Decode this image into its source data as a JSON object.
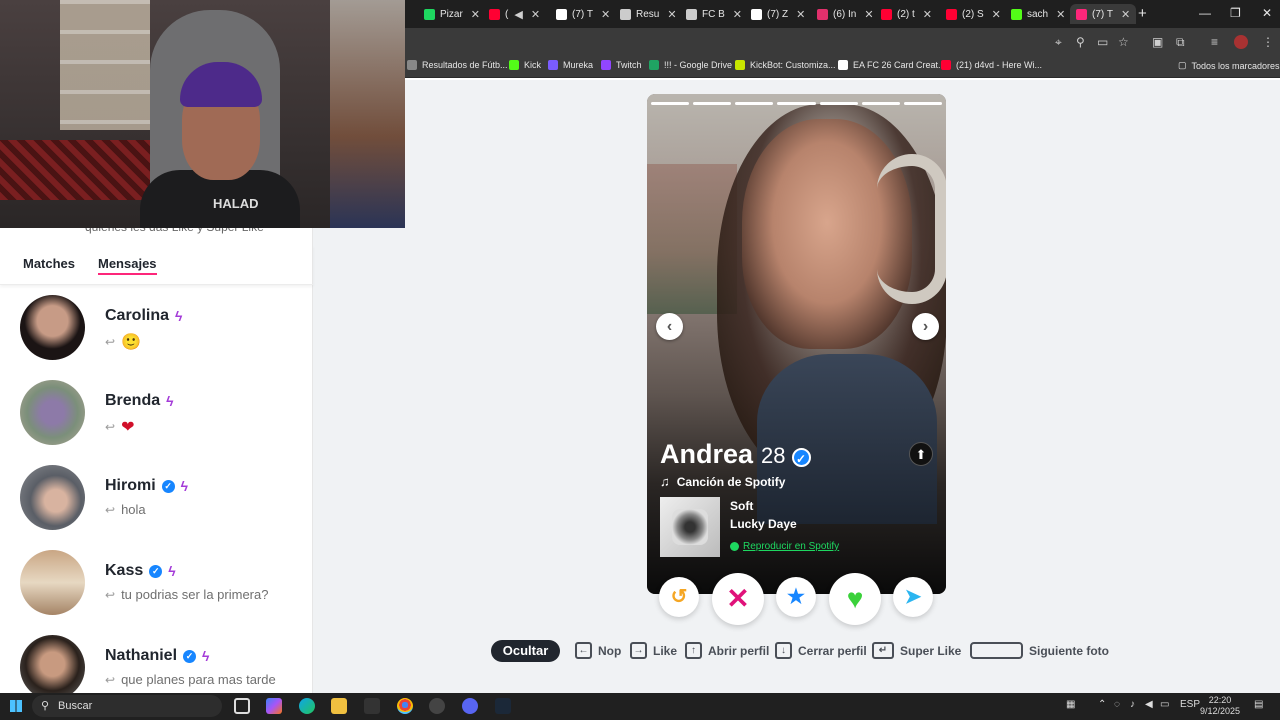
{
  "browser": {
    "tabs": [
      {
        "label": "Pizar",
        "color": "#1ed760"
      },
      {
        "label": "(",
        "color": "#ff0033"
      },
      {
        "label": "(7) T",
        "color": "#ffffff"
      },
      {
        "label": "Resu",
        "color": "#cccccc"
      },
      {
        "label": "FC B",
        "color": "#cccccc"
      },
      {
        "label": "(7) Z",
        "color": "#ffffff"
      },
      {
        "label": "(6) In",
        "color": "#e1306c"
      },
      {
        "label": "(2) t",
        "color": "#ff0033"
      },
      {
        "label": "(2) S",
        "color": "#ff0033"
      },
      {
        "label": "sach",
        "color": "#53fc18"
      },
      {
        "label": "(7) T",
        "color": "#fd267a"
      }
    ],
    "bookmarks": [
      {
        "label": "Resultados de Fútb...",
        "color": "#888888"
      },
      {
        "label": "Kick",
        "color": "#53fc18"
      },
      {
        "label": "Mureka",
        "color": "#7a5cff"
      },
      {
        "label": "Twitch",
        "color": "#9146ff"
      },
      {
        "label": "!!! - Google Drive",
        "color": "#1fa463"
      },
      {
        "label": "KickBot: Customiza...",
        "color": "#c8e600"
      },
      {
        "label": "EA FC 26 Card Creat...",
        "color": "#ffffff"
      },
      {
        "label": "(21) d4vd - Here Wi...",
        "color": "#ff0033"
      }
    ],
    "all_bookmarks": "Todos los marcadores"
  },
  "sidebar": {
    "subtitle": "quienes les das Like y Super Like",
    "tab_matches": "Matches",
    "tab_messages": "Mensajes",
    "conversations": [
      {
        "name": "Carolina",
        "message": "🙂",
        "verified": false
      },
      {
        "name": "Brenda",
        "message": "❤",
        "verified": false
      },
      {
        "name": "Hiromi",
        "message": "hola",
        "verified": true
      },
      {
        "name": "Kass",
        "message": "tu podrias ser la primera?",
        "verified": true
      },
      {
        "name": "Nathaniel",
        "message": "que planes para mas tarde",
        "verified": true
      }
    ]
  },
  "card": {
    "name": "Andrea",
    "age": "28",
    "spotify_label": "Canción de Spotify",
    "song": "Soft",
    "artist": "Lucky Daye",
    "play_label": "Reproducir en Spotify",
    "photo_index": 7,
    "photo_count": 7
  },
  "actions": {
    "rewind_icon": "rewind-icon",
    "nope_icon": "x-icon",
    "superlike_icon": "star-icon",
    "like_icon": "heart-icon",
    "boost_icon": "send-icon",
    "colors": {
      "rewind": "#f5a623",
      "nope": "#e0127a",
      "superlike": "#1786ff",
      "like": "#3ad13a",
      "boost": "#2bb5f0"
    }
  },
  "shortcuts": {
    "hide": "Ocultar",
    "nope": "Nop",
    "like": "Like",
    "open_profile": "Abrir perfil",
    "close_profile": "Cerrar perfil",
    "super_like": "Super Like",
    "next_photo": "Siguiente foto"
  },
  "webcam": {
    "shirt_text": "HALAD"
  },
  "taskbar": {
    "search": "Buscar",
    "lang": "ESP",
    "time": "22:20",
    "date": "9/12/2025"
  }
}
